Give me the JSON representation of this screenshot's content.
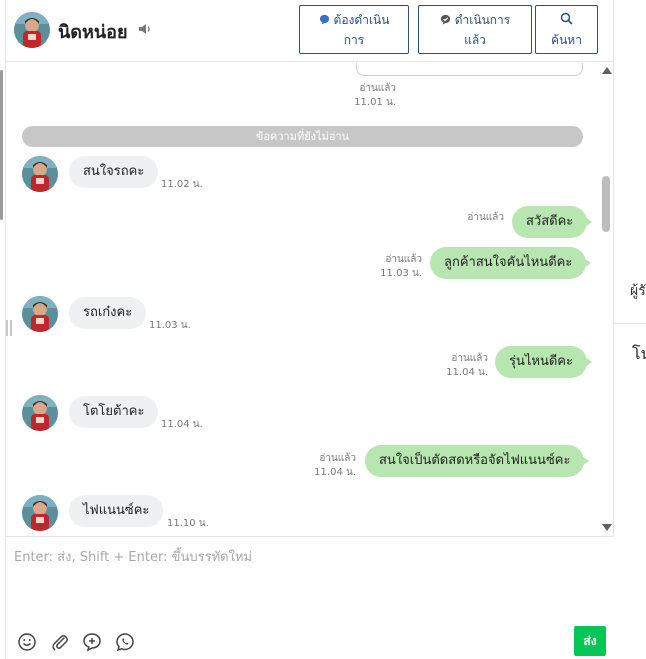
{
  "header": {
    "contact_name": "นิดหน่อย",
    "buttons": {
      "pending": {
        "line1": "ต้องดำเนิน",
        "line2": "การ"
      },
      "done": {
        "line1": "ดำเนินการ",
        "line2": "แล้ว"
      },
      "search": {
        "line1": "ค้นหา"
      }
    }
  },
  "previous": {
    "read": "อ่านแล้ว",
    "time": "11.01 น."
  },
  "unread_divider": "ข้อความที่ยังไม่อ่าน",
  "messages": [
    {
      "side": "in",
      "text": "สนใจรถคะ",
      "time": "11.02 น."
    },
    {
      "side": "out",
      "text": "สวัสดีคะ",
      "read": "อ่านแล้ว",
      "time": ""
    },
    {
      "side": "out",
      "text": "ลูกค้าสนใจคันไหนดีคะ",
      "read": "อ่านแล้ว",
      "time": "11.03 น."
    },
    {
      "side": "in",
      "text": "รถเก๋งคะ",
      "time": "11.03 น."
    },
    {
      "side": "out",
      "text": "รุ่นไหนดีคะ",
      "read": "อ่านแล้ว",
      "time": "11.04 น."
    },
    {
      "side": "in",
      "text": "โตโยต้าคะ",
      "time": "11.04 น."
    },
    {
      "side": "out",
      "text": "สนใจเป็นตัดสดหรือจัดไฟแนนซ์คะ",
      "read": "อ่านแล้ว",
      "time": "11.04 น."
    },
    {
      "side": "in",
      "text": "ไฟแนนซ์คะ",
      "time": "11.10 น."
    }
  ],
  "composer": {
    "placeholder": "Enter: ส่ง, Shift + Enter: ขึ้นบรรทัดใหม่",
    "send_label": "ส่ง"
  },
  "right_panel": {
    "label1": "ผู้รั",
    "label2": "โน"
  },
  "colors": {
    "accent": "#2c4e8a",
    "send": "#06c755",
    "out_bubble": "#b8e6b0",
    "in_bubble": "#eff0f2"
  }
}
